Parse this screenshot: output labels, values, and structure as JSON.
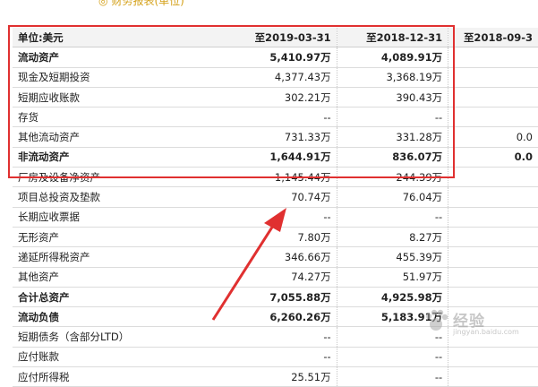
{
  "top_note": {
    "symbol": "◎",
    "text": "财务报表(单位)"
  },
  "table": {
    "headers": [
      "单位:美元",
      "至2019-03-31",
      "至2018-12-31",
      "至2018-09-3"
    ],
    "rows": [
      {
        "cells": [
          "流动资产",
          "5,410.97万",
          "4,089.91万",
          ""
        ],
        "bold": true
      },
      {
        "cells": [
          "现金及短期投资",
          "4,377.43万",
          "3,368.19万",
          ""
        ],
        "bold": false
      },
      {
        "cells": [
          "短期应收账款",
          "302.21万",
          "390.43万",
          ""
        ],
        "bold": false
      },
      {
        "cells": [
          "存货",
          "--",
          "--",
          ""
        ],
        "bold": false
      },
      {
        "cells": [
          "其他流动资产",
          "731.33万",
          "331.28万",
          "0.0"
        ],
        "bold": false
      },
      {
        "cells": [
          "非流动资产",
          "1,644.91万",
          "836.07万",
          "0.0"
        ],
        "bold": true
      },
      {
        "cells": [
          "厂房及设备净资产",
          "1,145.44万",
          "244.39万",
          ""
        ],
        "bold": false
      },
      {
        "cells": [
          "项目总投资及垫款",
          "70.74万",
          "76.04万",
          ""
        ],
        "bold": false
      },
      {
        "cells": [
          "长期应收票据",
          "--",
          "--",
          ""
        ],
        "bold": false
      },
      {
        "cells": [
          "无形资产",
          "7.80万",
          "8.27万",
          ""
        ],
        "bold": false
      },
      {
        "cells": [
          "递延所得税资产",
          "346.66万",
          "455.39万",
          ""
        ],
        "bold": false
      },
      {
        "cells": [
          "其他资产",
          "74.27万",
          "51.97万",
          ""
        ],
        "bold": false
      },
      {
        "cells": [
          "合计总资产",
          "7,055.88万",
          "4,925.98万",
          ""
        ],
        "bold": true
      },
      {
        "cells": [
          "流动负债",
          "6,260.26万",
          "5,183.91万",
          ""
        ],
        "bold": true
      },
      {
        "cells": [
          "短期债务（含部分LTD）",
          "--",
          "--",
          ""
        ],
        "bold": false
      },
      {
        "cells": [
          "应付账款",
          "--",
          "--",
          ""
        ],
        "bold": false
      },
      {
        "cells": [
          "应付所得税",
          "25.51万",
          "--",
          ""
        ],
        "bold": false
      }
    ]
  },
  "annotation": {
    "box_color": "#e03030",
    "arrow_color": "#e03030"
  },
  "watermark": {
    "main": "经验",
    "sub": "jingyan.baidu.com"
  }
}
